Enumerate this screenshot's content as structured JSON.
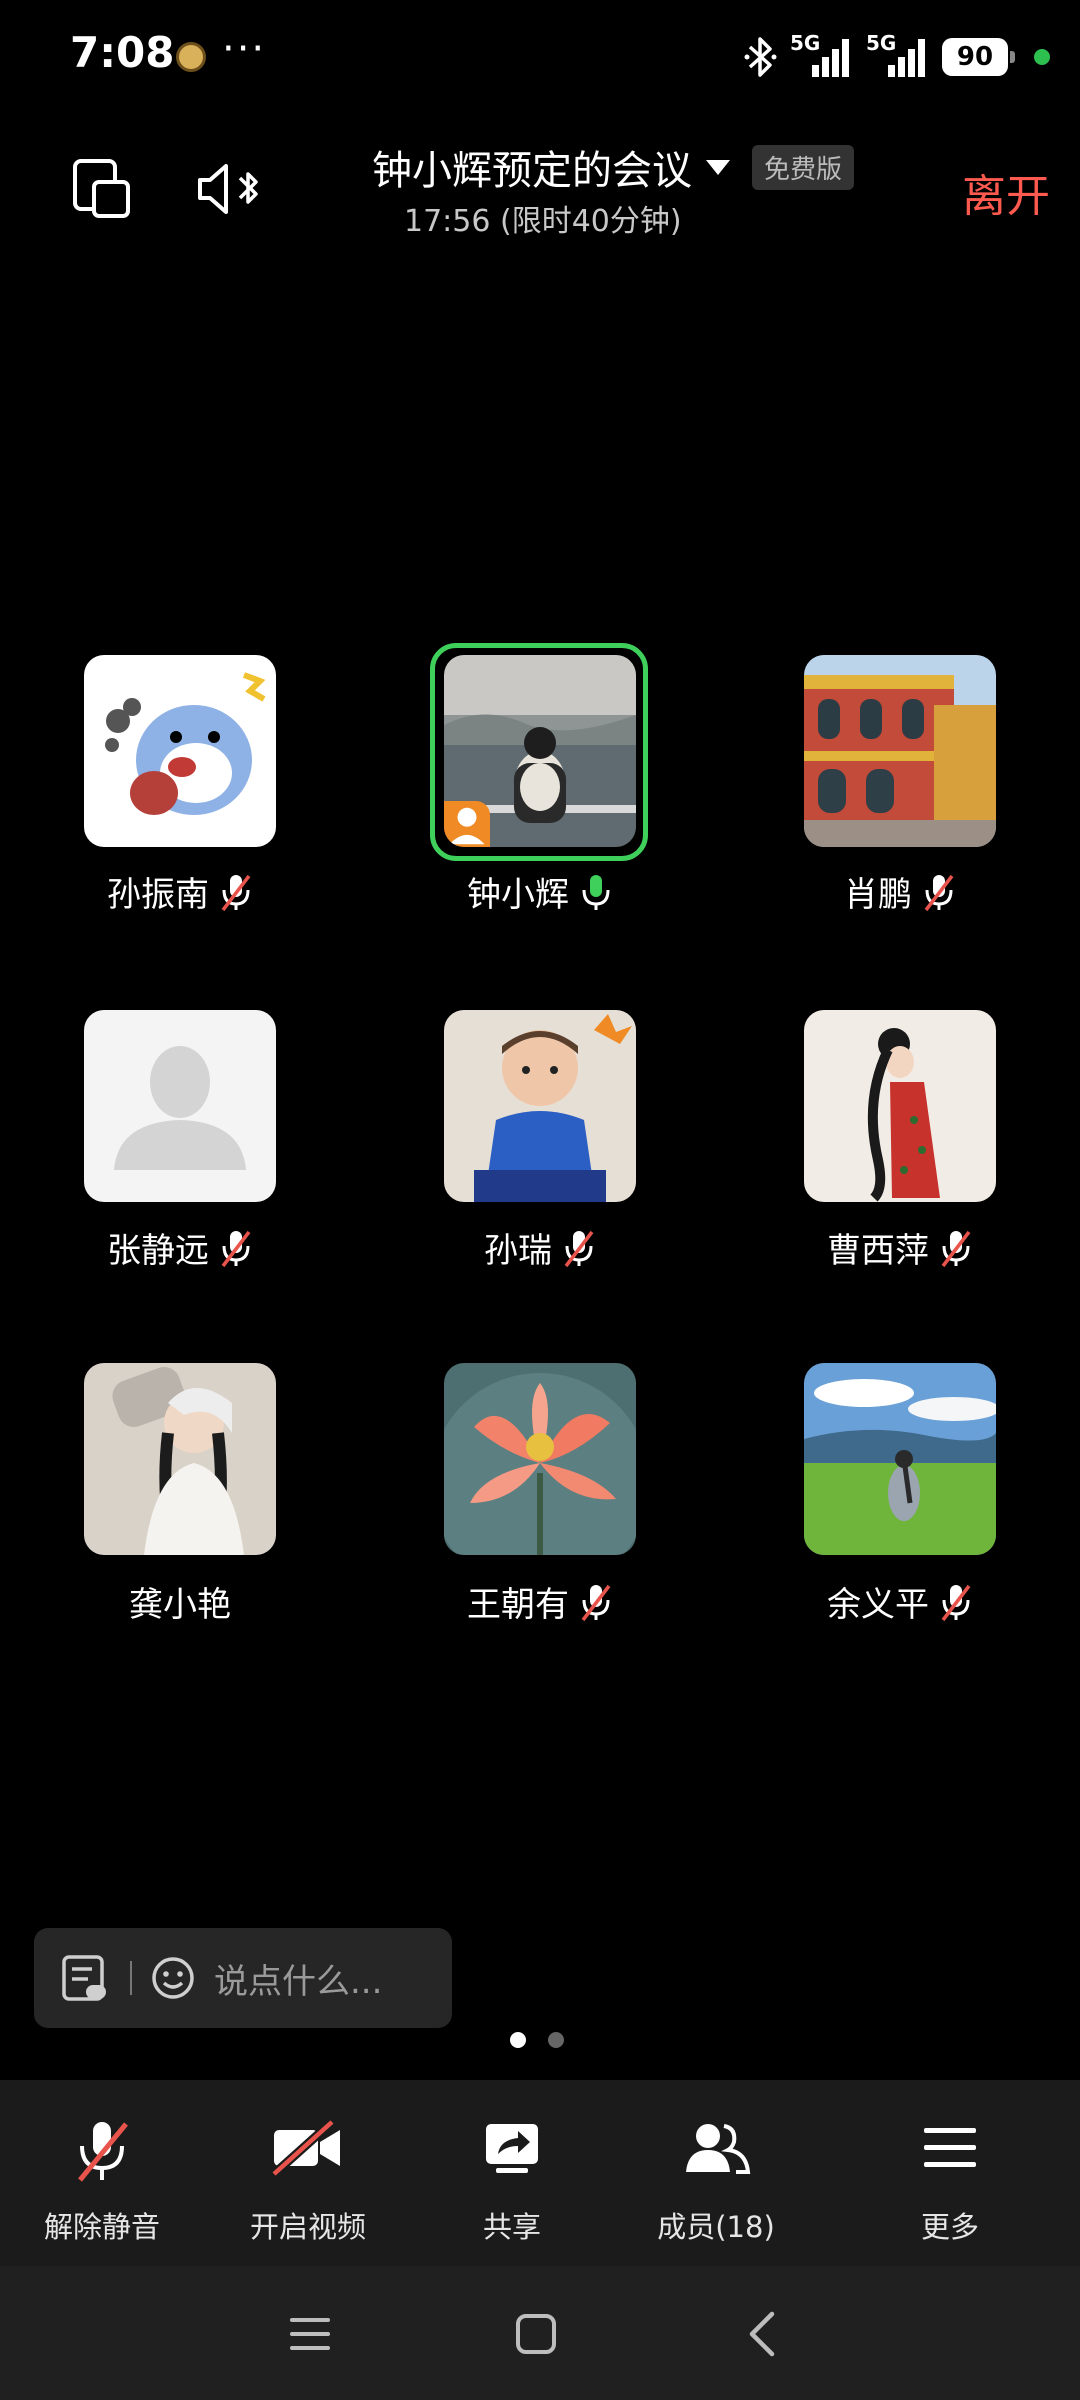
{
  "status_bar": {
    "time": "7:08",
    "more": "···",
    "net1": "5G",
    "net2": "5G",
    "battery": "90",
    "icons": [
      "app-notification-icon",
      "bluetooth-icon",
      "signal-5g-icon",
      "signal-5g-icon",
      "battery-icon",
      "privacy-indicator-dot"
    ]
  },
  "header": {
    "title": "钟小辉预定的会议",
    "edition": "免费版",
    "subtitle": "17:56 (限时40分钟)",
    "leave": "离开",
    "icons": [
      "switch-camera-icon",
      "bluetooth-audio-icon",
      "dropdown-caret-icon"
    ]
  },
  "participants": [
    {
      "name": "孙振南",
      "mic": "muted",
      "avatar": "cartoon-shark-avatar"
    },
    {
      "name": "钟小辉",
      "mic": "on",
      "avatar": "person-by-sea-avatar",
      "speaking": true,
      "host": true
    },
    {
      "name": "肖鹏",
      "mic": "muted",
      "avatar": "building-avatar"
    },
    {
      "name": "张静远",
      "mic": "muted",
      "avatar": "default-avatar"
    },
    {
      "name": "孙瑞",
      "mic": "muted",
      "avatar": "baby-avatar"
    },
    {
      "name": "曹西萍",
      "mic": "muted",
      "avatar": "illustrated-woman-avatar"
    },
    {
      "name": "龚小艳",
      "mic": "none",
      "avatar": "woman-drinking-avatar"
    },
    {
      "name": "王朝有",
      "mic": "muted",
      "avatar": "lotus-avatar"
    },
    {
      "name": "余义平",
      "mic": "muted",
      "avatar": "woman-on-grass-avatar"
    }
  ],
  "chat": {
    "placeholder": "说点什么...",
    "icons": [
      "chat-list-icon",
      "emoji-icon"
    ]
  },
  "pager": {
    "count": 2,
    "active": 0
  },
  "toolbar": [
    {
      "label": "解除静音",
      "icon": "mic-muted-icon"
    },
    {
      "label": "开启视频",
      "icon": "video-off-icon"
    },
    {
      "label": "共享",
      "icon": "share-screen-icon"
    },
    {
      "label": "成员(18)",
      "icon": "members-icon"
    },
    {
      "label": "更多",
      "icon": "more-menu-icon"
    }
  ],
  "colors": {
    "background": "#000000",
    "leave": "#ff5a4f",
    "speaking_ring": "#3fcf5b",
    "host_badge": "#f08a24",
    "mute_slash": "#e8544b",
    "toolbar_bg": "#1b1b1b"
  }
}
